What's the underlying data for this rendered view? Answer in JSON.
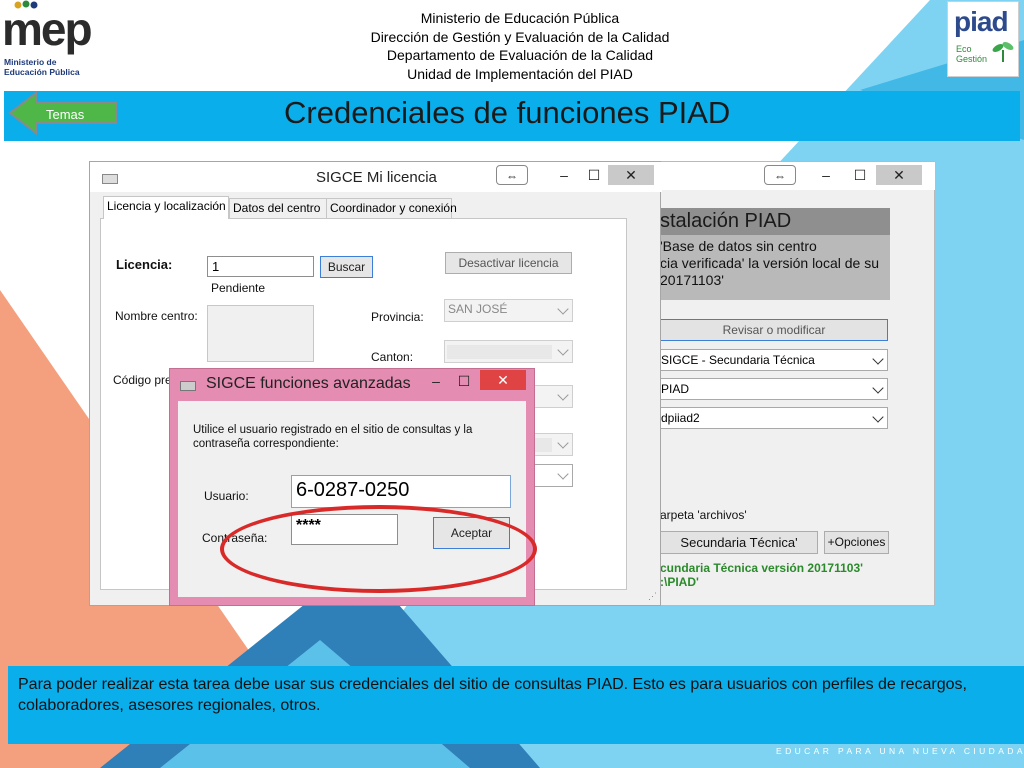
{
  "header": {
    "lines": [
      "Ministerio de Educación Pública",
      "Dirección de Gestión y Evaluación de la Calidad",
      "Departamento de Evaluación de la Calidad",
      "Unidad de Implementación del PIAD"
    ],
    "logo_left": {
      "word": "mep",
      "sub": "Ministerio de Educación Pública"
    },
    "logo_right": {
      "word": "piad",
      "sub1": "Eco",
      "sub2": "Gestión"
    }
  },
  "title_bar": {
    "title": "Credenciales de funciones PIAD",
    "back_button": "Temas"
  },
  "screenshot": {
    "main_window": {
      "title": "SIGCE Mi licencia",
      "tabs": [
        "Licencia y localización",
        "Datos del centro",
        "Coordinador y conexión"
      ],
      "licencia_label": "Licencia:",
      "licencia_value": "1",
      "buscar_button": "Buscar",
      "status": "Pendiente",
      "desactivar_button": "Desactivar licencia",
      "nombre_centro_label": "Nombre centro:",
      "provincia_label": "Provincia:",
      "provincia_value": "SAN JOSÉ",
      "canton_label": "Canton:",
      "codigo_label": "Código pres"
    },
    "back_window": {
      "heading": "stalación PIAD",
      "line1": "'Base de datos sin centro",
      "line2": "cia verificada' la versión local de su",
      "line3": "20171103'",
      "revisar_button": "Revisar o modificar",
      "select1": "SIGCE - Secundaria Técnica",
      "select2": "PIAD",
      "select3": "dpiiad2",
      "folder_text": "arpeta 'archivos'",
      "version_button": "Secundaria Técnica'",
      "opciones_button": "+Opciones",
      "green_line1": "cundaria Técnica versión 20171103'",
      "green_line2": ":\\PIAD'"
    },
    "dialog": {
      "title": "SIGCE funciones avanzadas",
      "instruction": "Utilice el usuario registrado en el sitio de consultas y la contraseña correspondiente:",
      "usuario_label": "Usuario:",
      "usuario_value": "6-0287-0250",
      "contrasena_label": "Contraseña:",
      "contrasena_value": "****",
      "aceptar_button": "Aceptar"
    }
  },
  "info_text": "Para poder realizar esta tarea debe usar sus credenciales del sitio de consultas PIAD. Esto es para usuarios con perfiles de recargos, colaboradores, asesores regionales, otros.",
  "tagline": "EDUCAR PARA UNA NUEVA CIUDADANÍA",
  "colors": {
    "accent_blue": "#0aaeea",
    "light_blue": "#7fd3f2",
    "orange": "#f4a07f",
    "highlight_red": "#d92a2a",
    "dialog_pink": "#e48cb1"
  }
}
